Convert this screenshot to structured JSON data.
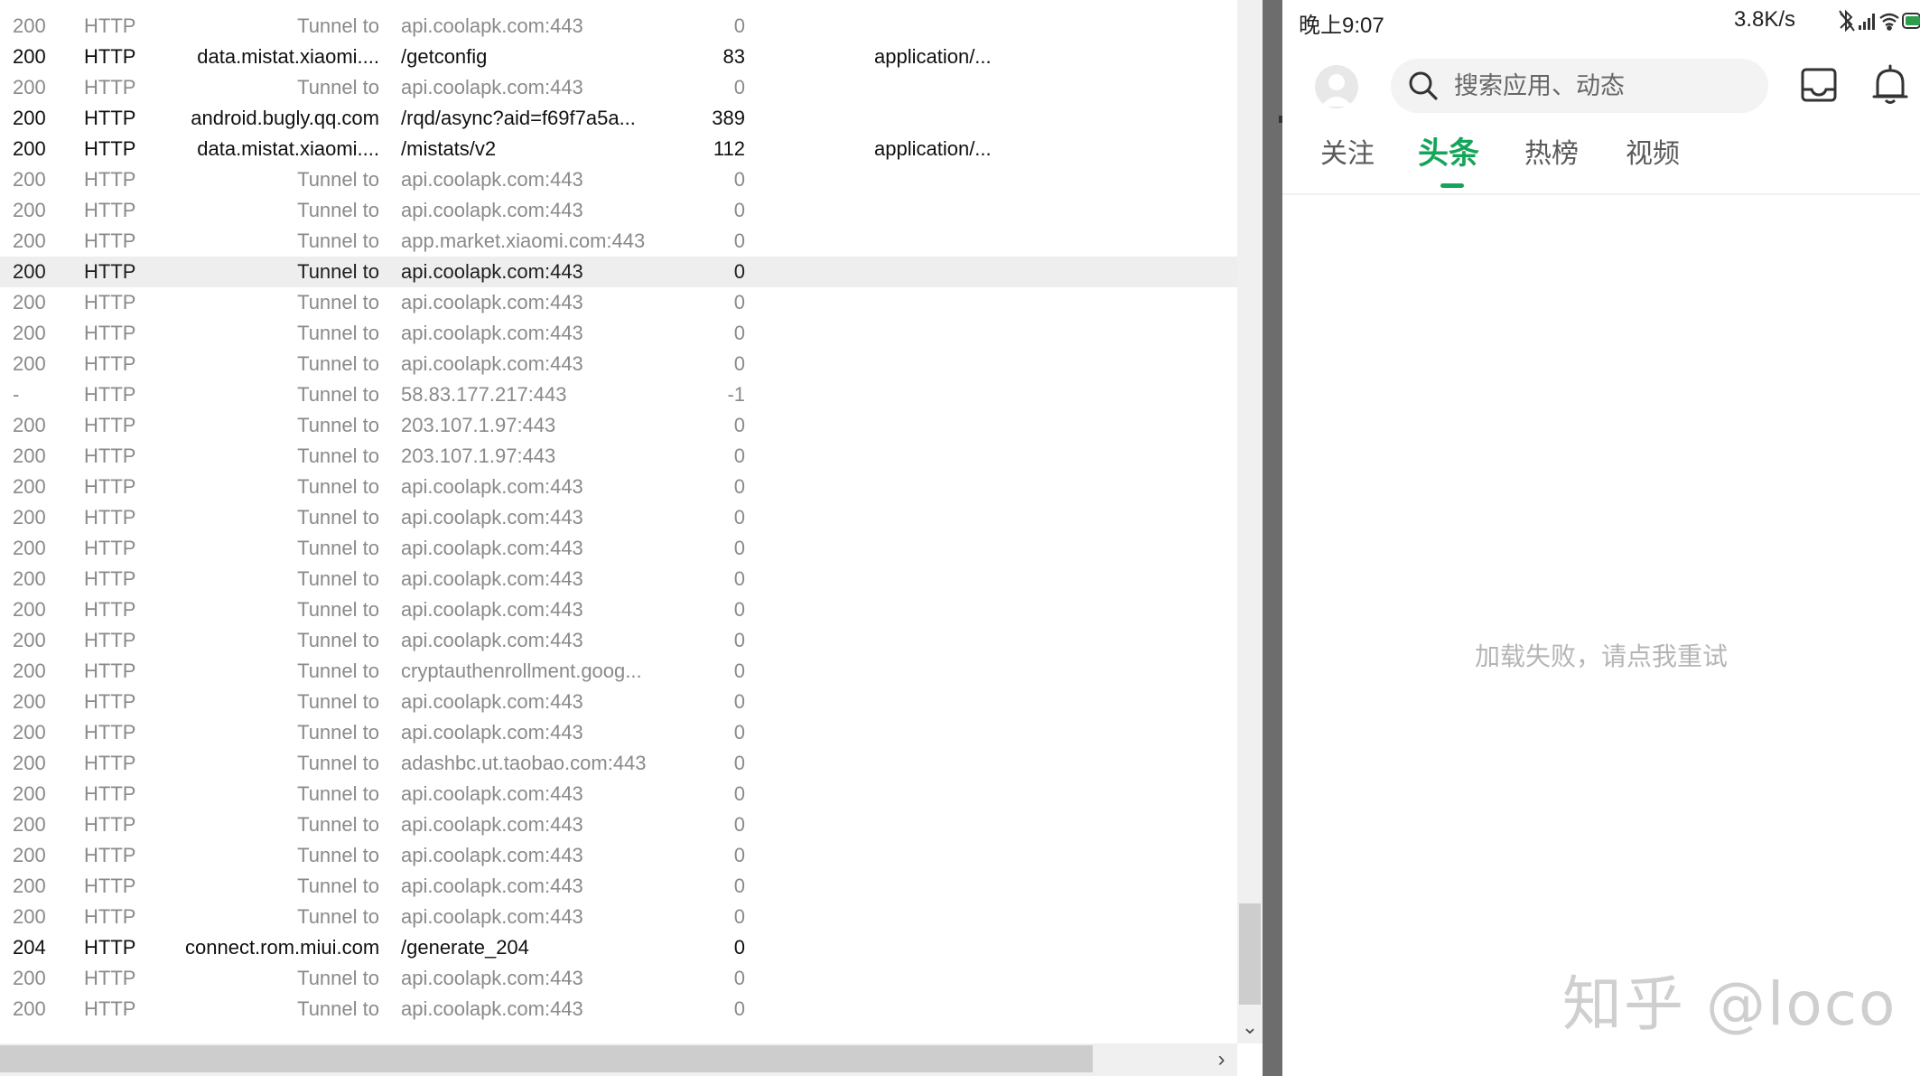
{
  "capture": {
    "rows": [
      {
        "result": "200",
        "protocol": "HTTP",
        "host": "Tunnel to",
        "url": "api.coolapk.com:443",
        "body": "0",
        "content_type": "",
        "kind": "tunnel"
      },
      {
        "result": "200",
        "protocol": "HTTP",
        "host": "data.mistat.xiaomi....",
        "url": "/getconfig",
        "body": "83",
        "content_type": "application/...",
        "kind": "normal"
      },
      {
        "result": "200",
        "protocol": "HTTP",
        "host": "Tunnel to",
        "url": "api.coolapk.com:443",
        "body": "0",
        "content_type": "",
        "kind": "tunnel"
      },
      {
        "result": "200",
        "protocol": "HTTP",
        "host": "android.bugly.qq.com",
        "url": "/rqd/async?aid=f69f7a5a...",
        "body": "389",
        "content_type": "",
        "kind": "normal"
      },
      {
        "result": "200",
        "protocol": "HTTP",
        "host": "data.mistat.xiaomi....",
        "url": "/mistats/v2",
        "body": "112",
        "content_type": "application/...",
        "kind": "normal"
      },
      {
        "result": "200",
        "protocol": "HTTP",
        "host": "Tunnel to",
        "url": "api.coolapk.com:443",
        "body": "0",
        "content_type": "",
        "kind": "tunnel"
      },
      {
        "result": "200",
        "protocol": "HTTP",
        "host": "Tunnel to",
        "url": "api.coolapk.com:443",
        "body": "0",
        "content_type": "",
        "kind": "tunnel"
      },
      {
        "result": "200",
        "protocol": "HTTP",
        "host": "Tunnel to",
        "url": "app.market.xiaomi.com:443",
        "body": "0",
        "content_type": "",
        "kind": "tunnel"
      },
      {
        "result": "200",
        "protocol": "HTTP",
        "host": "Tunnel to",
        "url": "api.coolapk.com:443",
        "body": "0",
        "content_type": "",
        "kind": "tunnel",
        "selected": true
      },
      {
        "result": "200",
        "protocol": "HTTP",
        "host": "Tunnel to",
        "url": "api.coolapk.com:443",
        "body": "0",
        "content_type": "",
        "kind": "tunnel"
      },
      {
        "result": "200",
        "protocol": "HTTP",
        "host": "Tunnel to",
        "url": "api.coolapk.com:443",
        "body": "0",
        "content_type": "",
        "kind": "tunnel"
      },
      {
        "result": "200",
        "protocol": "HTTP",
        "host": "Tunnel to",
        "url": "api.coolapk.com:443",
        "body": "0",
        "content_type": "",
        "kind": "tunnel"
      },
      {
        "result": "-",
        "protocol": "HTTP",
        "host": "Tunnel to",
        "url": "58.83.177.217:443",
        "body": "-1",
        "content_type": "",
        "kind": "tunnel"
      },
      {
        "result": "200",
        "protocol": "HTTP",
        "host": "Tunnel to",
        "url": "203.107.1.97:443",
        "body": "0",
        "content_type": "",
        "kind": "tunnel"
      },
      {
        "result": "200",
        "protocol": "HTTP",
        "host": "Tunnel to",
        "url": "203.107.1.97:443",
        "body": "0",
        "content_type": "",
        "kind": "tunnel"
      },
      {
        "result": "200",
        "protocol": "HTTP",
        "host": "Tunnel to",
        "url": "api.coolapk.com:443",
        "body": "0",
        "content_type": "",
        "kind": "tunnel"
      },
      {
        "result": "200",
        "protocol": "HTTP",
        "host": "Tunnel to",
        "url": "api.coolapk.com:443",
        "body": "0",
        "content_type": "",
        "kind": "tunnel"
      },
      {
        "result": "200",
        "protocol": "HTTP",
        "host": "Tunnel to",
        "url": "api.coolapk.com:443",
        "body": "0",
        "content_type": "",
        "kind": "tunnel"
      },
      {
        "result": "200",
        "protocol": "HTTP",
        "host": "Tunnel to",
        "url": "api.coolapk.com:443",
        "body": "0",
        "content_type": "",
        "kind": "tunnel"
      },
      {
        "result": "200",
        "protocol": "HTTP",
        "host": "Tunnel to",
        "url": "api.coolapk.com:443",
        "body": "0",
        "content_type": "",
        "kind": "tunnel"
      },
      {
        "result": "200",
        "protocol": "HTTP",
        "host": "Tunnel to",
        "url": "api.coolapk.com:443",
        "body": "0",
        "content_type": "",
        "kind": "tunnel"
      },
      {
        "result": "200",
        "protocol": "HTTP",
        "host": "Tunnel to",
        "url": "cryptauthenrollment.goog...",
        "body": "0",
        "content_type": "",
        "kind": "tunnel"
      },
      {
        "result": "200",
        "protocol": "HTTP",
        "host": "Tunnel to",
        "url": "api.coolapk.com:443",
        "body": "0",
        "content_type": "",
        "kind": "tunnel"
      },
      {
        "result": "200",
        "protocol": "HTTP",
        "host": "Tunnel to",
        "url": "api.coolapk.com:443",
        "body": "0",
        "content_type": "",
        "kind": "tunnel"
      },
      {
        "result": "200",
        "protocol": "HTTP",
        "host": "Tunnel to",
        "url": "adashbc.ut.taobao.com:443",
        "body": "0",
        "content_type": "",
        "kind": "tunnel"
      },
      {
        "result": "200",
        "protocol": "HTTP",
        "host": "Tunnel to",
        "url": "api.coolapk.com:443",
        "body": "0",
        "content_type": "",
        "kind": "tunnel"
      },
      {
        "result": "200",
        "protocol": "HTTP",
        "host": "Tunnel to",
        "url": "api.coolapk.com:443",
        "body": "0",
        "content_type": "",
        "kind": "tunnel"
      },
      {
        "result": "200",
        "protocol": "HTTP",
        "host": "Tunnel to",
        "url": "api.coolapk.com:443",
        "body": "0",
        "content_type": "",
        "kind": "tunnel"
      },
      {
        "result": "200",
        "protocol": "HTTP",
        "host": "Tunnel to",
        "url": "api.coolapk.com:443",
        "body": "0",
        "content_type": "",
        "kind": "tunnel"
      },
      {
        "result": "200",
        "protocol": "HTTP",
        "host": "Tunnel to",
        "url": "api.coolapk.com:443",
        "body": "0",
        "content_type": "",
        "kind": "tunnel"
      },
      {
        "result": "204",
        "protocol": "HTTP",
        "host": "connect.rom.miui.com",
        "url": "/generate_204",
        "body": "0",
        "content_type": "",
        "kind": "normal"
      },
      {
        "result": "200",
        "protocol": "HTTP",
        "host": "Tunnel to",
        "url": "api.coolapk.com:443",
        "body": "0",
        "content_type": "",
        "kind": "tunnel"
      },
      {
        "result": "200",
        "protocol": "HTTP",
        "host": "Tunnel to",
        "url": "api.coolapk.com:443",
        "body": "0",
        "content_type": "",
        "kind": "tunnel"
      }
    ],
    "scroll_down_glyph": "⌄",
    "scroll_right_glyph": "›"
  },
  "phone": {
    "status_bar": {
      "time": "晚上9:07",
      "net_speed": "3.8K/s",
      "icons": [
        "bluetooth-off-icon",
        "signal-icon",
        "wifi-icon",
        "battery-icon"
      ]
    },
    "search": {
      "placeholder": "搜索应用、动态",
      "icon": "search-icon"
    },
    "header_icons": [
      "avatar",
      "inbox-icon",
      "bell-icon"
    ],
    "tabs": [
      {
        "label": "关注",
        "active": false
      },
      {
        "label": "头条",
        "active": true
      },
      {
        "label": "热榜",
        "active": false
      },
      {
        "label": "视频",
        "active": false
      }
    ],
    "load_error": "加载失败，请点我重试",
    "watermark": "知乎 @loco",
    "colors": {
      "accent": "#14a55a",
      "muted_text": "#b5b5b5"
    }
  }
}
